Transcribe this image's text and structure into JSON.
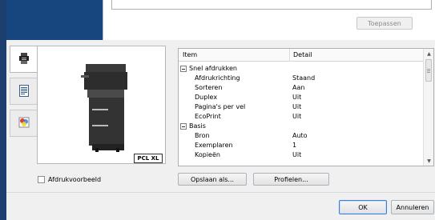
{
  "top": {
    "apply_label": "Toepassen"
  },
  "tabs": [
    {
      "icon": "printer-icon"
    },
    {
      "icon": "document-icon"
    },
    {
      "icon": "color-icon"
    }
  ],
  "preview": {
    "pdl_badge": "PCL XL",
    "preview_checkbox_label": "Afdrukvoorbeeld",
    "preview_checked": false
  },
  "table": {
    "col_item": "Item",
    "col_detail": "Detail",
    "rows": [
      {
        "type": "group",
        "item": "Snel afdrukken",
        "detail": ""
      },
      {
        "type": "entry",
        "item": "Afdrukrichting",
        "detail": "Staand"
      },
      {
        "type": "entry",
        "item": "Sorteren",
        "detail": "Aan"
      },
      {
        "type": "entry",
        "item": "Duplex",
        "detail": "Uit"
      },
      {
        "type": "entry",
        "item": "Pagina's per vel",
        "detail": "Uit"
      },
      {
        "type": "entry",
        "item": "EcoPrint",
        "detail": "Uit"
      },
      {
        "type": "group",
        "item": "Basis",
        "detail": ""
      },
      {
        "type": "entry",
        "item": "Bron",
        "detail": "Auto"
      },
      {
        "type": "entry",
        "item": "Exemplaren",
        "detail": "1"
      },
      {
        "type": "entry",
        "item": "Kopieën",
        "detail": "Uit"
      }
    ]
  },
  "buttons": {
    "save_as": "Opslaan als...",
    "profiles": "Profielen...",
    "ok": "OK",
    "cancel": "Annuleren"
  }
}
